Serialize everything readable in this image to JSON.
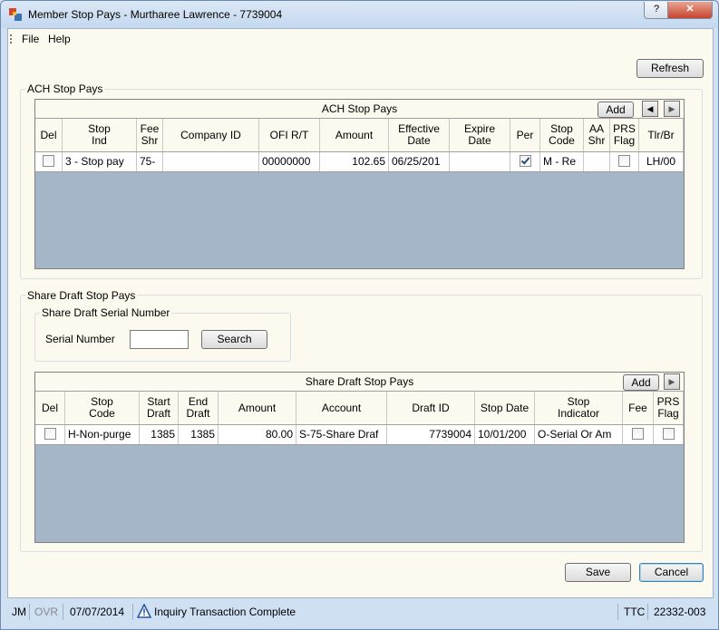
{
  "window": {
    "title": "Member Stop Pays - Murtharee Lawrence - 7739004",
    "help_label": "?",
    "close_label": "✕"
  },
  "menu": {
    "file": "File",
    "help": "Help"
  },
  "toolbar": {
    "refresh_label": "Refresh"
  },
  "ach": {
    "group_label": "ACH Stop Pays",
    "grid_caption": "ACH Stop Pays",
    "add_label": "Add",
    "columns": {
      "del": "Del",
      "stop_ind_1": "Stop",
      "stop_ind_2": "Ind",
      "fee_shr_1": "Fee",
      "fee_shr_2": "Shr",
      "company_id": "Company ID",
      "ofi_rt": "OFI R/T",
      "amount": "Amount",
      "effective_1": "Effective",
      "effective_2": "Date",
      "expire_1": "Expire",
      "expire_2": "Date",
      "per": "Per",
      "stop_code_1": "Stop",
      "stop_code_2": "Code",
      "aa_shr_1": "AA",
      "aa_shr_2": "Shr",
      "prs_flag_1": "PRS",
      "prs_flag_2": "Flag",
      "tlr_br": "Tlr/Br"
    },
    "rows": [
      {
        "del": false,
        "stop_ind": "3 - Stop pay",
        "fee_shr": "75-",
        "company_id": "",
        "ofi_rt": "00000000",
        "amount": "102.65",
        "effective_date": "06/25/201",
        "expire_date": "",
        "per": true,
        "stop_code": "M - Re",
        "aa_shr": "",
        "prs_flag": false,
        "tlr_br": "LH/00"
      }
    ]
  },
  "share_draft": {
    "group_label": "Share Draft Stop Pays",
    "serial_group_label": "Share Draft Serial Number",
    "serial_label": "Serial Number",
    "serial_value": "",
    "search_label": "Search",
    "grid_caption": "Share Draft Stop Pays",
    "add_label": "Add",
    "columns": {
      "del": "Del",
      "stop_code_1": "Stop",
      "stop_code_2": "Code",
      "start_1": "Start",
      "start_2": "Draft",
      "end_1": "End",
      "end_2": "Draft",
      "amount": "Amount",
      "account": "Account",
      "draft_id": "Draft ID",
      "stop_date": "Stop Date",
      "stop_ind_1": "Stop",
      "stop_ind_2": "Indicator",
      "fee": "Fee",
      "prs_1": "PRS",
      "prs_2": "Flag"
    },
    "rows": [
      {
        "del": false,
        "stop_code": "H-Non-purge",
        "start_draft": "1385",
        "end_draft": "1385",
        "amount": "80.00",
        "account": "S-75-Share Draf",
        "draft_id": "7739004",
        "stop_date": "10/01/200",
        "stop_indicator": "O-Serial Or Am",
        "fee": false,
        "prs_flag": false
      }
    ]
  },
  "footer": {
    "save_label": "Save",
    "cancel_label": "Cancel"
  },
  "status": {
    "user": "JM",
    "ovr": "OVR",
    "date": "07/07/2014",
    "message": "Inquiry Transaction Complete",
    "ttc_label": "TTC",
    "ttc_value": "22332-003"
  },
  "colors": {
    "grid_background": "#a5b6c9",
    "client_background": "#fcf9ee",
    "frame": "#cfe0f3"
  }
}
